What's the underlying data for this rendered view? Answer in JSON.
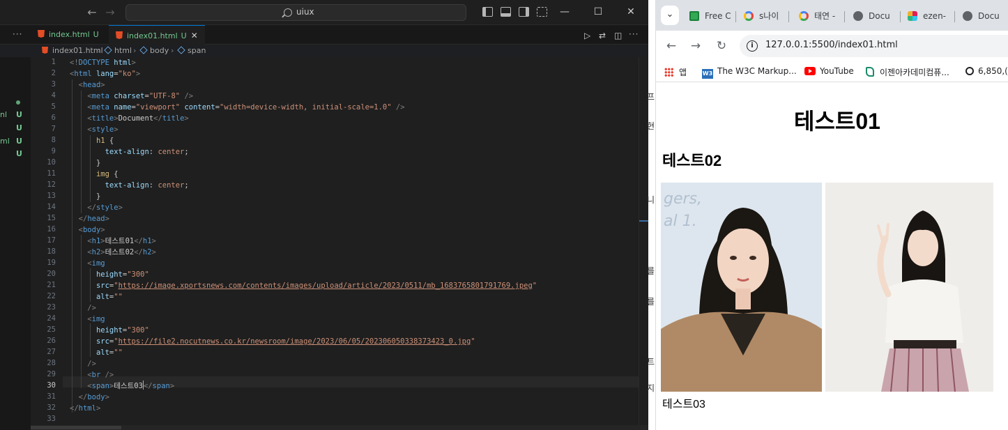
{
  "vscode": {
    "search_text": "uiux",
    "tabs": [
      {
        "label": "index.html",
        "status": "U"
      },
      {
        "label": "index01.html",
        "status": "U"
      }
    ],
    "breadcrumb": [
      "index01.html",
      "html",
      "body",
      "span"
    ],
    "explorer_rows": [
      {
        "name": "nl",
        "status": "U"
      },
      {
        "name": "",
        "status": "U"
      },
      {
        "name": "ml",
        "status": "U"
      },
      {
        "name": "",
        "status": "U"
      }
    ],
    "current_line": 30,
    "line_numbers": [
      "1",
      "2",
      "3",
      "4",
      "5",
      "6",
      "7",
      "8",
      "9",
      "10",
      "11",
      "12",
      "13",
      "14",
      "15",
      "16",
      "17",
      "18",
      "19",
      "20",
      "21",
      "22",
      "23",
      "24",
      "25",
      "26",
      "27",
      "28",
      "29",
      "30",
      "31",
      "32",
      "33"
    ],
    "code": {
      "doctype": "<!DOCTYPE html>",
      "html_lang": "ko",
      "charset": "UTF-8",
      "viewport_name": "viewport",
      "viewport_content": "width=device-width, initial-scale=1.0",
      "title": "Document",
      "h1_selector": "h1",
      "img_selector": "img",
      "prop": "text-align",
      "prop_value": "center",
      "h1_text": "테스트01",
      "h2_text": "테스트02",
      "img_height": "300",
      "img1_src": "https://image.xportsnews.com/contents/images/upload/article/2023/0511/mb_1683765801791769.jpeg",
      "img2_src": "https://file2.nocutnews.co.kr/newsroom/image/2023/06/05/202306050338373423_0.jpg",
      "img_alt": "",
      "span_text_a": "테스트0",
      "span_text_b": "3"
    }
  },
  "chrome": {
    "tabs": [
      {
        "label": "Free C",
        "icon": "sheets-icon"
      },
      {
        "label": "s나이",
        "icon": "google-icon"
      },
      {
        "label": "태연 -",
        "icon": "google-icon"
      },
      {
        "label": "Docu",
        "icon": "globe-icon"
      },
      {
        "label": "ezen-",
        "icon": "slack-icon"
      },
      {
        "label": "Docu",
        "icon": "globe-icon"
      }
    ],
    "url": "127.0.0.1:5500/index01.html",
    "bookmarks": [
      {
        "label": "앱",
        "icon": "apps-grid-icon"
      },
      {
        "label": "The W3C Markup...",
        "icon": "w3c-icon"
      },
      {
        "label": "YouTube",
        "icon": "youtube-icon"
      },
      {
        "label": "이젠아카데미컴퓨...",
        "icon": "ezen-icon"
      },
      {
        "label": "6,850,(",
        "icon": "coin-icon"
      }
    ],
    "page": {
      "h1": "테스트01",
      "h2": "테스트02",
      "span": "테스트03"
    }
  },
  "peek_text": [
    "프",
    "현",
    "니",
    "를",
    "를",
    "트",
    "지"
  ]
}
